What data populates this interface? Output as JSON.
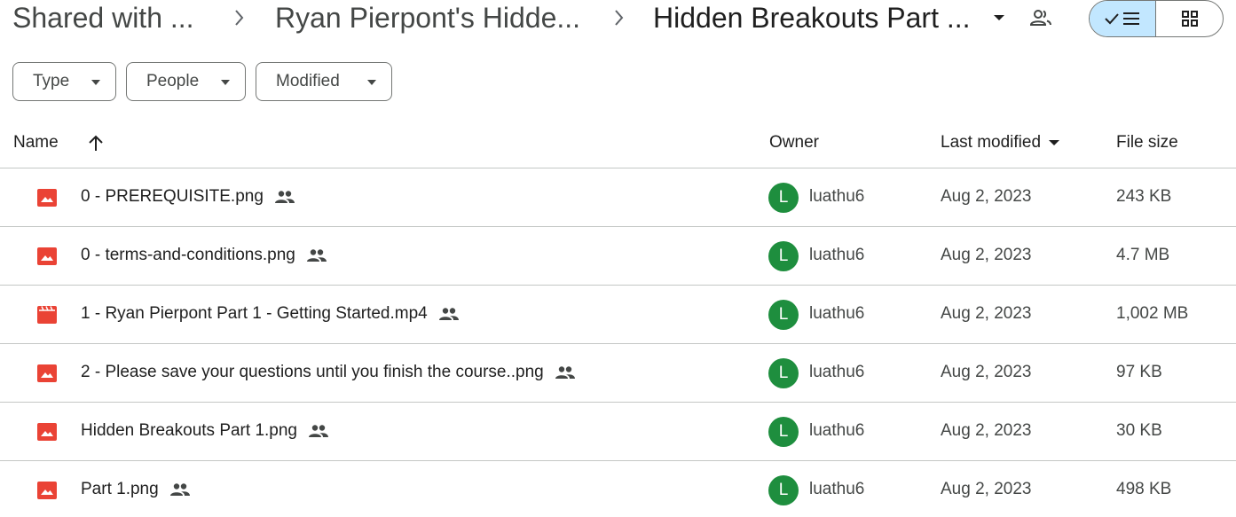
{
  "breadcrumb": {
    "items": [
      "Shared with ...",
      "Ryan Pierpont's Hidde...",
      "Hidden Breakouts Part ..."
    ]
  },
  "filters": [
    "Type",
    "People",
    "Modified"
  ],
  "columns": {
    "name": "Name",
    "owner": "Owner",
    "last_modified": "Last modified",
    "file_size": "File size"
  },
  "colors": {
    "image_icon": "#ea4335",
    "video_icon": "#ea4335",
    "avatar": "#1e8e3e",
    "active_view": "#c2e7ff"
  },
  "files": [
    {
      "name": "0 - PREREQUISITE.png",
      "type": "image",
      "owner": "luathu6",
      "avatar": "L",
      "modified": "Aug 2, 2023",
      "size": "243 KB"
    },
    {
      "name": "0 - terms-and-conditions.png",
      "type": "image",
      "owner": "luathu6",
      "avatar": "L",
      "modified": "Aug 2, 2023",
      "size": "4.7 MB"
    },
    {
      "name": "1 - Ryan Pierpont Part 1 - Getting Started.mp4",
      "type": "video",
      "owner": "luathu6",
      "avatar": "L",
      "modified": "Aug 2, 2023",
      "size": "1,002 MB"
    },
    {
      "name": "2 - Please save your questions until you finish the course..png",
      "type": "image",
      "owner": "luathu6",
      "avatar": "L",
      "modified": "Aug 2, 2023",
      "size": "97 KB"
    },
    {
      "name": "Hidden Breakouts Part 1.png",
      "type": "image",
      "owner": "luathu6",
      "avatar": "L",
      "modified": "Aug 2, 2023",
      "size": "30 KB"
    },
    {
      "name": "Part 1.png",
      "type": "image",
      "owner": "luathu6",
      "avatar": "L",
      "modified": "Aug 2, 2023",
      "size": "498 KB"
    }
  ]
}
